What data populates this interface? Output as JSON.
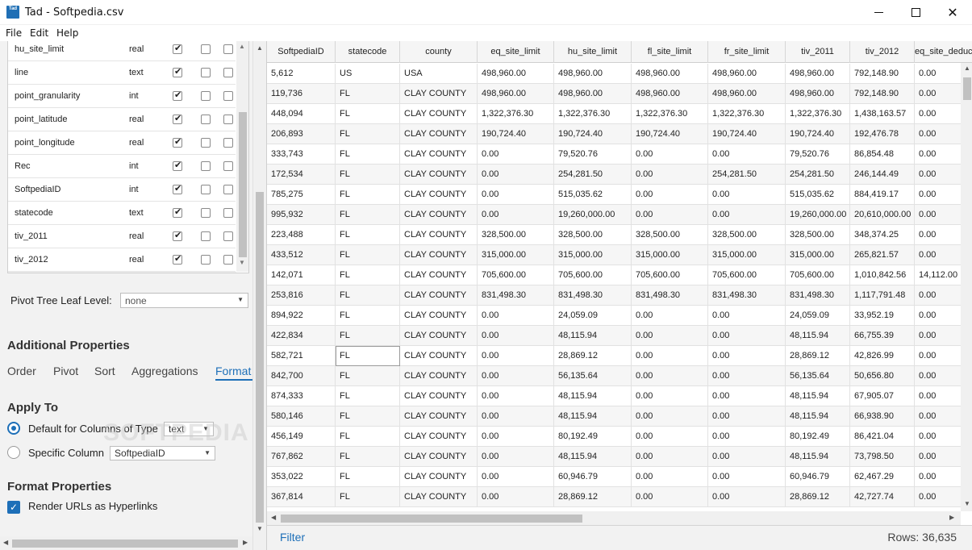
{
  "window": {
    "title": "Tad - Softpedia.csv",
    "icon_text": "Tad"
  },
  "menu": [
    "File",
    "Edit",
    "Help"
  ],
  "columns_list": [
    {
      "name": "hu_site_limit",
      "type": "real",
      "checks": [
        true,
        false,
        false
      ]
    },
    {
      "name": "line",
      "type": "text",
      "checks": [
        true,
        false,
        false
      ]
    },
    {
      "name": "point_granularity",
      "type": "int",
      "checks": [
        true,
        false,
        false
      ]
    },
    {
      "name": "point_latitude",
      "type": "real",
      "checks": [
        true,
        false,
        false
      ]
    },
    {
      "name": "point_longitude",
      "type": "real",
      "checks": [
        true,
        false,
        false
      ]
    },
    {
      "name": "Rec",
      "type": "int",
      "checks": [
        true,
        false,
        false
      ]
    },
    {
      "name": "SoftpediaID",
      "type": "int",
      "checks": [
        true,
        false,
        false
      ]
    },
    {
      "name": "statecode",
      "type": "text",
      "checks": [
        true,
        false,
        false
      ]
    },
    {
      "name": "tiv_2011",
      "type": "real",
      "checks": [
        true,
        false,
        false
      ]
    },
    {
      "name": "tiv_2012",
      "type": "real",
      "checks": [
        true,
        false,
        false
      ]
    }
  ],
  "pivot_leaf": {
    "label": "Pivot Tree Leaf Level:",
    "value": "none"
  },
  "additional_properties": {
    "title": "Additional Properties",
    "tabs": [
      "Order",
      "Pivot",
      "Sort",
      "Aggregations",
      "Format"
    ],
    "active_tab": "Format"
  },
  "apply_to": {
    "title": "Apply To",
    "default_label": "Default for Columns of Type",
    "default_type": "text",
    "specific_label": "Specific Column",
    "specific_value": "SoftpediaID"
  },
  "format_properties": {
    "title": "Format Properties",
    "render_urls_label": "Render URLs as Hyperlinks",
    "render_urls_checked": true
  },
  "grid": {
    "headers": [
      "SoftpediaID",
      "statecode",
      "county",
      "eq_site_limit",
      "hu_site_limit",
      "fl_site_limit",
      "fr_site_limit",
      "tiv_2011",
      "tiv_2012",
      "eq_site_deductible"
    ],
    "rows": [
      [
        "5,612",
        "US",
        "USA",
        "498,960.00",
        "498,960.00",
        "498,960.00",
        "498,960.00",
        "498,960.00",
        "792,148.90",
        "0.00"
      ],
      [
        "119,736",
        "FL",
        "CLAY COUNTY",
        "498,960.00",
        "498,960.00",
        "498,960.00",
        "498,960.00",
        "498,960.00",
        "792,148.90",
        "0.00"
      ],
      [
        "448,094",
        "FL",
        "CLAY COUNTY",
        "1,322,376.30",
        "1,322,376.30",
        "1,322,376.30",
        "1,322,376.30",
        "1,322,376.30",
        "1,438,163.57",
        "0.00"
      ],
      [
        "206,893",
        "FL",
        "CLAY COUNTY",
        "190,724.40",
        "190,724.40",
        "190,724.40",
        "190,724.40",
        "190,724.40",
        "192,476.78",
        "0.00"
      ],
      [
        "333,743",
        "FL",
        "CLAY COUNTY",
        "0.00",
        "79,520.76",
        "0.00",
        "0.00",
        "79,520.76",
        "86,854.48",
        "0.00"
      ],
      [
        "172,534",
        "FL",
        "CLAY COUNTY",
        "0.00",
        "254,281.50",
        "0.00",
        "254,281.50",
        "254,281.50",
        "246,144.49",
        "0.00"
      ],
      [
        "785,275",
        "FL",
        "CLAY COUNTY",
        "0.00",
        "515,035.62",
        "0.00",
        "0.00",
        "515,035.62",
        "884,419.17",
        "0.00"
      ],
      [
        "995,932",
        "FL",
        "CLAY COUNTY",
        "0.00",
        "19,260,000.00",
        "0.00",
        "0.00",
        "19,260,000.00",
        "20,610,000.00",
        "0.00"
      ],
      [
        "223,488",
        "FL",
        "CLAY COUNTY",
        "328,500.00",
        "328,500.00",
        "328,500.00",
        "328,500.00",
        "328,500.00",
        "348,374.25",
        "0.00"
      ],
      [
        "433,512",
        "FL",
        "CLAY COUNTY",
        "315,000.00",
        "315,000.00",
        "315,000.00",
        "315,000.00",
        "315,000.00",
        "265,821.57",
        "0.00"
      ],
      [
        "142,071",
        "FL",
        "CLAY COUNTY",
        "705,600.00",
        "705,600.00",
        "705,600.00",
        "705,600.00",
        "705,600.00",
        "1,010,842.56",
        "14,112.00"
      ],
      [
        "253,816",
        "FL",
        "CLAY COUNTY",
        "831,498.30",
        "831,498.30",
        "831,498.30",
        "831,498.30",
        "831,498.30",
        "1,117,791.48",
        "0.00"
      ],
      [
        "894,922",
        "FL",
        "CLAY COUNTY",
        "0.00",
        "24,059.09",
        "0.00",
        "0.00",
        "24,059.09",
        "33,952.19",
        "0.00"
      ],
      [
        "422,834",
        "FL",
        "CLAY COUNTY",
        "0.00",
        "48,115.94",
        "0.00",
        "0.00",
        "48,115.94",
        "66,755.39",
        "0.00"
      ],
      [
        "582,721",
        "FL",
        "CLAY COUNTY",
        "0.00",
        "28,869.12",
        "0.00",
        "0.00",
        "28,869.12",
        "42,826.99",
        "0.00"
      ],
      [
        "842,700",
        "FL",
        "CLAY COUNTY",
        "0.00",
        "56,135.64",
        "0.00",
        "0.00",
        "56,135.64",
        "50,656.80",
        "0.00"
      ],
      [
        "874,333",
        "FL",
        "CLAY COUNTY",
        "0.00",
        "48,115.94",
        "0.00",
        "0.00",
        "48,115.94",
        "67,905.07",
        "0.00"
      ],
      [
        "580,146",
        "FL",
        "CLAY COUNTY",
        "0.00",
        "48,115.94",
        "0.00",
        "0.00",
        "48,115.94",
        "66,938.90",
        "0.00"
      ],
      [
        "456,149",
        "FL",
        "CLAY COUNTY",
        "0.00",
        "80,192.49",
        "0.00",
        "0.00",
        "80,192.49",
        "86,421.04",
        "0.00"
      ],
      [
        "767,862",
        "FL",
        "CLAY COUNTY",
        "0.00",
        "48,115.94",
        "0.00",
        "0.00",
        "48,115.94",
        "73,798.50",
        "0.00"
      ],
      [
        "353,022",
        "FL",
        "CLAY COUNTY",
        "0.00",
        "60,946.79",
        "0.00",
        "0.00",
        "60,946.79",
        "62,467.29",
        "0.00"
      ],
      [
        "367,814",
        "FL",
        "CLAY COUNTY",
        "0.00",
        "28,869.12",
        "0.00",
        "0.00",
        "28,869.12",
        "42,727.74",
        "0.00"
      ]
    ],
    "selected_cell": {
      "row": 14,
      "col": 1
    }
  },
  "footer": {
    "filter_label": "Filter",
    "rows_label": "Rows: 36,635"
  },
  "watermark": "SOFTPEDIA",
  "colors": {
    "accent": "#1d6fb8",
    "panel_bg": "#f2f2f2"
  }
}
